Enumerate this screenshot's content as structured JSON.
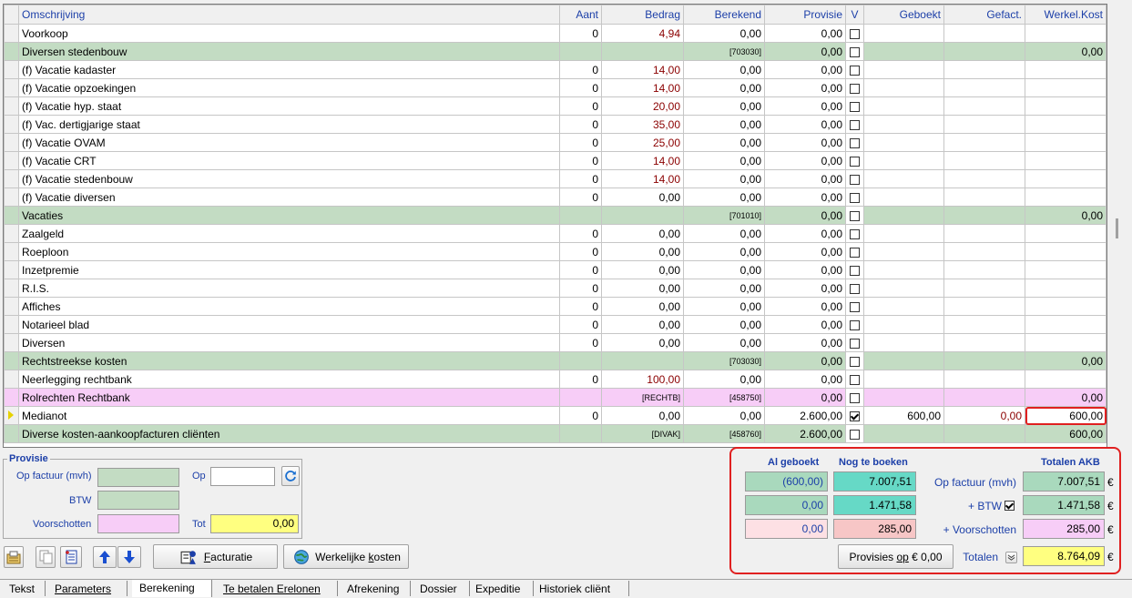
{
  "grid": {
    "headers": {
      "omschrijving": "Omschrijving",
      "aant": "Aant",
      "bedrag": "Bedrag",
      "berekend": "Berekend",
      "provisie": "Provisie",
      "v": "V",
      "geboekt": "Geboekt",
      "gefact": "Gefact.",
      "werkel": "Werkel.Kost"
    },
    "rows": [
      {
        "type": "item",
        "omschrijving": "Voorkoop",
        "aant": "0",
        "bedrag": "4,94",
        "bedrag_red": true,
        "berekend": "0,00",
        "provisie": "0,00",
        "v": false,
        "geboekt": "",
        "gefact": "",
        "werkel": ""
      },
      {
        "type": "grp",
        "omschrijving": "Diversen stedenbouw",
        "aant": "",
        "bedrag": "",
        "berekend": "[703030]",
        "provisie": "0,00",
        "v": false,
        "geboekt": "",
        "gefact": "",
        "werkel": "0,00"
      },
      {
        "type": "item",
        "omschrijving": "(f) Vacatie kadaster",
        "aant": "0",
        "bedrag": "14,00",
        "bedrag_red": true,
        "berekend": "0,00",
        "provisie": "0,00",
        "v": false,
        "geboekt": "",
        "gefact": "",
        "werkel": ""
      },
      {
        "type": "item",
        "omschrijving": "(f) Vacatie opzoekingen",
        "aant": "0",
        "bedrag": "14,00",
        "bedrag_red": true,
        "berekend": "0,00",
        "provisie": "0,00",
        "v": false,
        "geboekt": "",
        "gefact": "",
        "werkel": ""
      },
      {
        "type": "item",
        "omschrijving": "(f) Vacatie hyp. staat",
        "aant": "0",
        "bedrag": "20,00",
        "bedrag_red": true,
        "berekend": "0,00",
        "provisie": "0,00",
        "v": false,
        "geboekt": "",
        "gefact": "",
        "werkel": ""
      },
      {
        "type": "item",
        "omschrijving": "(f) Vac. dertigjarige staat",
        "aant": "0",
        "bedrag": "35,00",
        "bedrag_red": true,
        "berekend": "0,00",
        "provisie": "0,00",
        "v": false,
        "geboekt": "",
        "gefact": "",
        "werkel": ""
      },
      {
        "type": "item",
        "omschrijving": "(f) Vacatie OVAM",
        "aant": "0",
        "bedrag": "25,00",
        "bedrag_red": true,
        "berekend": "0,00",
        "provisie": "0,00",
        "v": false,
        "geboekt": "",
        "gefact": "",
        "werkel": ""
      },
      {
        "type": "item",
        "omschrijving": "(f) Vacatie CRT",
        "aant": "0",
        "bedrag": "14,00",
        "bedrag_red": true,
        "berekend": "0,00",
        "provisie": "0,00",
        "v": false,
        "geboekt": "",
        "gefact": "",
        "werkel": ""
      },
      {
        "type": "item",
        "omschrijving": "(f) Vacatie stedenbouw",
        "aant": "0",
        "bedrag": "14,00",
        "bedrag_red": true,
        "berekend": "0,00",
        "provisie": "0,00",
        "v": false,
        "geboekt": "",
        "gefact": "",
        "werkel": ""
      },
      {
        "type": "item",
        "omschrijving": "(f) Vacatie diversen",
        "aant": "0",
        "bedrag": "0,00",
        "bedrag_red": false,
        "berekend": "0,00",
        "provisie": "0,00",
        "v": false,
        "geboekt": "",
        "gefact": "",
        "werkel": ""
      },
      {
        "type": "grp",
        "omschrijving": "Vacaties",
        "aant": "",
        "bedrag": "",
        "berekend": "[701010]",
        "provisie": "0,00",
        "v": false,
        "geboekt": "",
        "gefact": "",
        "werkel": "0,00"
      },
      {
        "type": "item",
        "omschrijving": "Zaalgeld",
        "aant": "0",
        "bedrag": "0,00",
        "bedrag_red": false,
        "berekend": "0,00",
        "provisie": "0,00",
        "v": false,
        "geboekt": "",
        "gefact": "",
        "werkel": ""
      },
      {
        "type": "item",
        "omschrijving": "Roeploon",
        "aant": "0",
        "bedrag": "0,00",
        "bedrag_red": false,
        "berekend": "0,00",
        "provisie": "0,00",
        "v": false,
        "geboekt": "",
        "gefact": "",
        "werkel": ""
      },
      {
        "type": "item",
        "omschrijving": "Inzetpremie",
        "aant": "0",
        "bedrag": "0,00",
        "bedrag_red": false,
        "berekend": "0,00",
        "provisie": "0,00",
        "v": false,
        "geboekt": "",
        "gefact": "",
        "werkel": ""
      },
      {
        "type": "item",
        "omschrijving": "R.I.S.",
        "aant": "0",
        "bedrag": "0,00",
        "bedrag_red": false,
        "berekend": "0,00",
        "provisie": "0,00",
        "v": false,
        "geboekt": "",
        "gefact": "",
        "werkel": ""
      },
      {
        "type": "item",
        "omschrijving": "Affiches",
        "aant": "0",
        "bedrag": "0,00",
        "bedrag_red": false,
        "berekend": "0,00",
        "provisie": "0,00",
        "v": false,
        "geboekt": "",
        "gefact": "",
        "werkel": ""
      },
      {
        "type": "item",
        "omschrijving": "Notarieel blad",
        "aant": "0",
        "bedrag": "0,00",
        "bedrag_red": false,
        "berekend": "0,00",
        "provisie": "0,00",
        "v": false,
        "geboekt": "",
        "gefact": "",
        "werkel": ""
      },
      {
        "type": "item",
        "omschrijving": "Diversen",
        "aant": "0",
        "bedrag": "0,00",
        "bedrag_red": false,
        "berekend": "0,00",
        "provisie": "0,00",
        "v": false,
        "geboekt": "",
        "gefact": "",
        "werkel": ""
      },
      {
        "type": "grp",
        "omschrijving": "Rechtstreekse kosten",
        "aant": "",
        "bedrag": "",
        "berekend": "[703030]",
        "provisie": "0,00",
        "v": false,
        "geboekt": "",
        "gefact": "",
        "werkel": "0,00"
      },
      {
        "type": "item",
        "omschrijving": "Neerlegging rechtbank",
        "aant": "0",
        "bedrag": "100,00",
        "bedrag_red": true,
        "berekend": "0,00",
        "provisie": "0,00",
        "v": false,
        "geboekt": "",
        "gefact": "",
        "werkel": ""
      },
      {
        "type": "pink",
        "omschrijving": "Rolrechten Rechtbank",
        "aant": "",
        "bedrag": "[RECHTB]",
        "berekend": "[458750]",
        "provisie": "0,00",
        "v": false,
        "geboekt": "",
        "gefact": "",
        "werkel": "0,00"
      },
      {
        "type": "item",
        "current": true,
        "omschrijving": "Medianot",
        "aant": "0",
        "bedrag": "0,00",
        "bedrag_red": false,
        "berekend": "0,00",
        "provisie": "2.600,00",
        "v": true,
        "geboekt": "600,00",
        "gefact": "0,00",
        "gefact_red": true,
        "werkel": "600,00",
        "werkel_hl": true
      },
      {
        "type": "grp",
        "omschrijving": "Diverse kosten-aankoopfacturen cliënten",
        "aant": "",
        "bedrag": "[DIVAK]",
        "berekend": "[458760]",
        "provisie": "2.600,00",
        "v": false,
        "geboekt": "",
        "gefact": "",
        "werkel": "600,00"
      }
    ]
  },
  "provisie": {
    "legend": "Provisie",
    "op_factuur_label": "Op factuur (mvh)",
    "btw_label": "BTW",
    "voorschotten_label": "Voorschotten",
    "op_label": "Op",
    "tot_label": "Tot",
    "tot_value": "0,00",
    "op_value": ""
  },
  "toolbar": {
    "facturatie_pre": "F",
    "facturatie_rest": "acturatie",
    "werkelijke_pre": "Werkelijke ",
    "werkelijke_u": "k",
    "werkelijke_rest": "osten"
  },
  "akb": {
    "h_al_geboekt": "Al geboekt",
    "h_nog_te_boeken": "Nog te boeken",
    "h_totalen": "Totalen AKB",
    "row1": {
      "al": "(600,00)",
      "nog": "7.007,51",
      "label": "Op factuur (mvh)",
      "tot": "7.007,51"
    },
    "row2": {
      "al": "0,00",
      "nog": "1.471,58",
      "label": "+ BTW",
      "tot": "1.471,58"
    },
    "row3": {
      "al": "0,00",
      "nog": "285,00",
      "label": "+ Voorschotten",
      "tot": "285,00"
    },
    "provisies_pre": "Provisies ",
    "provisies_u": "op",
    "provisies_rest": " € 0,00",
    "totalen_label": "Totalen",
    "totalen_value": "8.764,09",
    "currency": "€",
    "btw_checked": true
  },
  "tabs": [
    {
      "label": "Tekst"
    },
    {
      "label": "Parameters"
    },
    {
      "label": "Berekening",
      "active": true
    },
    {
      "label": "Te betalen Erelonen"
    },
    {
      "label": "Afrekening"
    },
    {
      "label": "Dossier"
    },
    {
      "label": "Expeditie"
    },
    {
      "label": "Historiek cliënt"
    }
  ],
  "colors": {
    "group_green": "#c3dcc3",
    "pink": "#f7cdf7",
    "teal": "#66d9c6",
    "akb_green": "#a9d9bd",
    "yellow": "#ffff80",
    "accent_blue": "#1c3fa8",
    "highlight_red": "#e02020"
  }
}
